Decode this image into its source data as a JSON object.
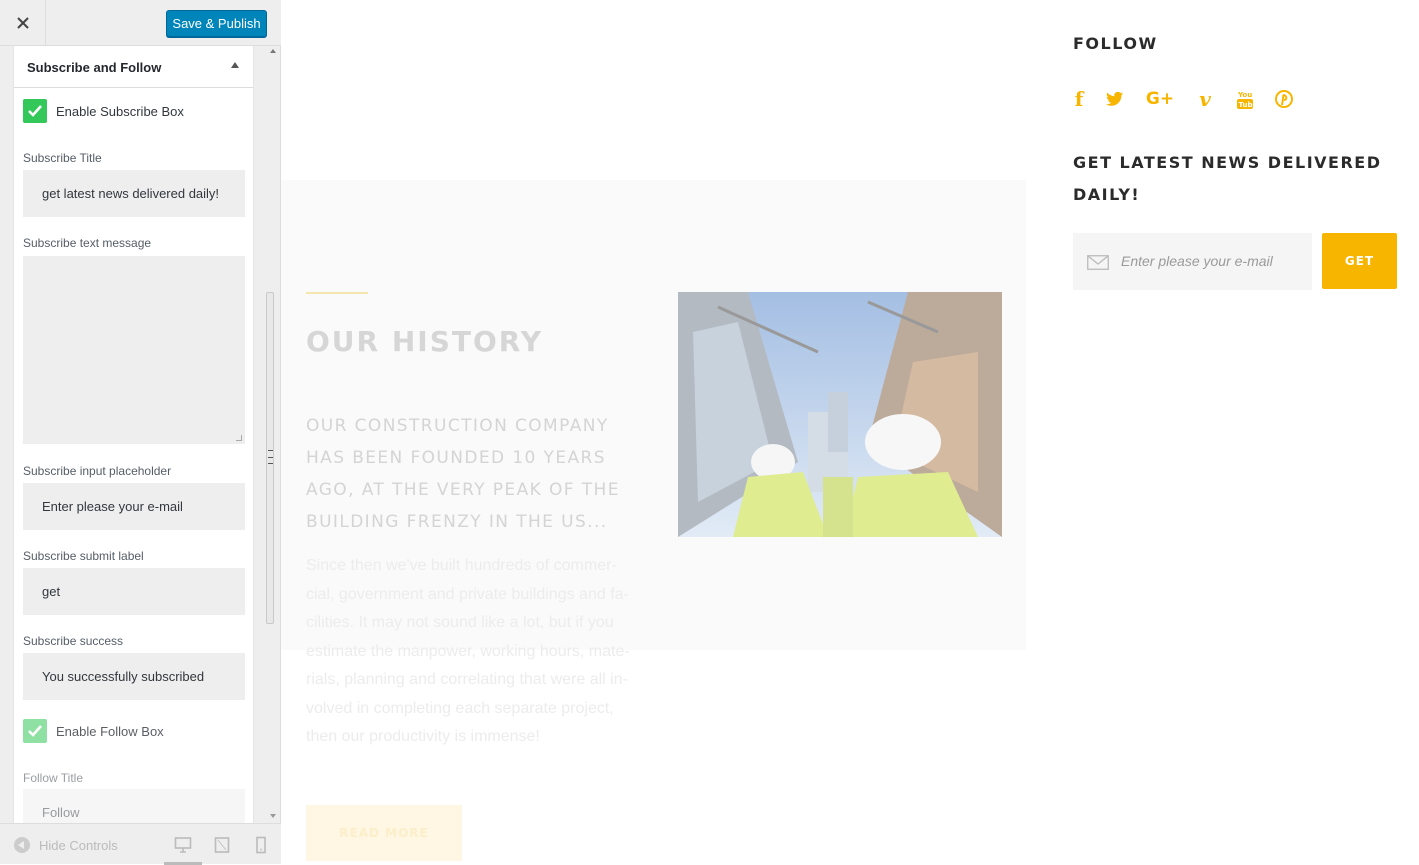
{
  "toolbar": {
    "close_label": "×",
    "publish_label": "Save & Publish"
  },
  "section": {
    "title": "Subscribe and Follow",
    "enable_subscribe_label": "Enable Subscribe Box",
    "enable_subscribe_checked": true,
    "subscribe_title_label": "Subscribe Title",
    "subscribe_title_value": "get latest news delivered daily!",
    "subscribe_text_label": "Subscribe text message",
    "subscribe_text_value": "",
    "subscribe_placeholder_label": "Subscribe input placeholder",
    "subscribe_placeholder_value": "Enter please your e-mail",
    "subscribe_submit_label": "Subscribe submit label",
    "subscribe_submit_value": "get",
    "subscribe_success_label": "Subscribe success",
    "subscribe_success_value": "You successfully subscribed",
    "enable_follow_label": "Enable Follow Box",
    "enable_follow_checked": true,
    "follow_title_label": "Follow Title",
    "follow_title_value": "Follow"
  },
  "footer": {
    "hide_controls_label": "Hide Controls",
    "devices": [
      "desktop-icon",
      "tablet-icon",
      "mobile-icon"
    ],
    "active_device": "desktop"
  },
  "preview": {
    "history_title": "OUR HISTORY",
    "history_lead": "OUR CONSTRUCTION COMPANY HAS BEEN FOUNDED 10 YEARS AGO, AT THE VERY PEAK OF THE BUILDING FRENZY IN THE US...",
    "history_body": "Since then we've built hundreds of commer-cial, government and private buildings and fa-cilities. It may not sound like a lot, but if you estimate the manpower, working hours, mate-rials, planning and correlating that were all in-volved in completing each separate project, then our productivity is immense!",
    "read_more_label": "READ MORE",
    "follow_title": "FOLLOW",
    "social_icons": [
      "facebook-icon",
      "twitter-icon",
      "google-plus-icon",
      "vimeo-icon",
      "youtube-icon",
      "pinterest-icon"
    ],
    "news_title": "GET LATEST NEWS DELIVERED DAILY!",
    "subscribe_placeholder": "Enter please your e-mail",
    "get_label": "GET"
  },
  "colors": {
    "accent": "#f7b500",
    "publish_button": "#0085ba",
    "checkbox": "#34c759",
    "sidebar_bg": "#eeeeee"
  }
}
